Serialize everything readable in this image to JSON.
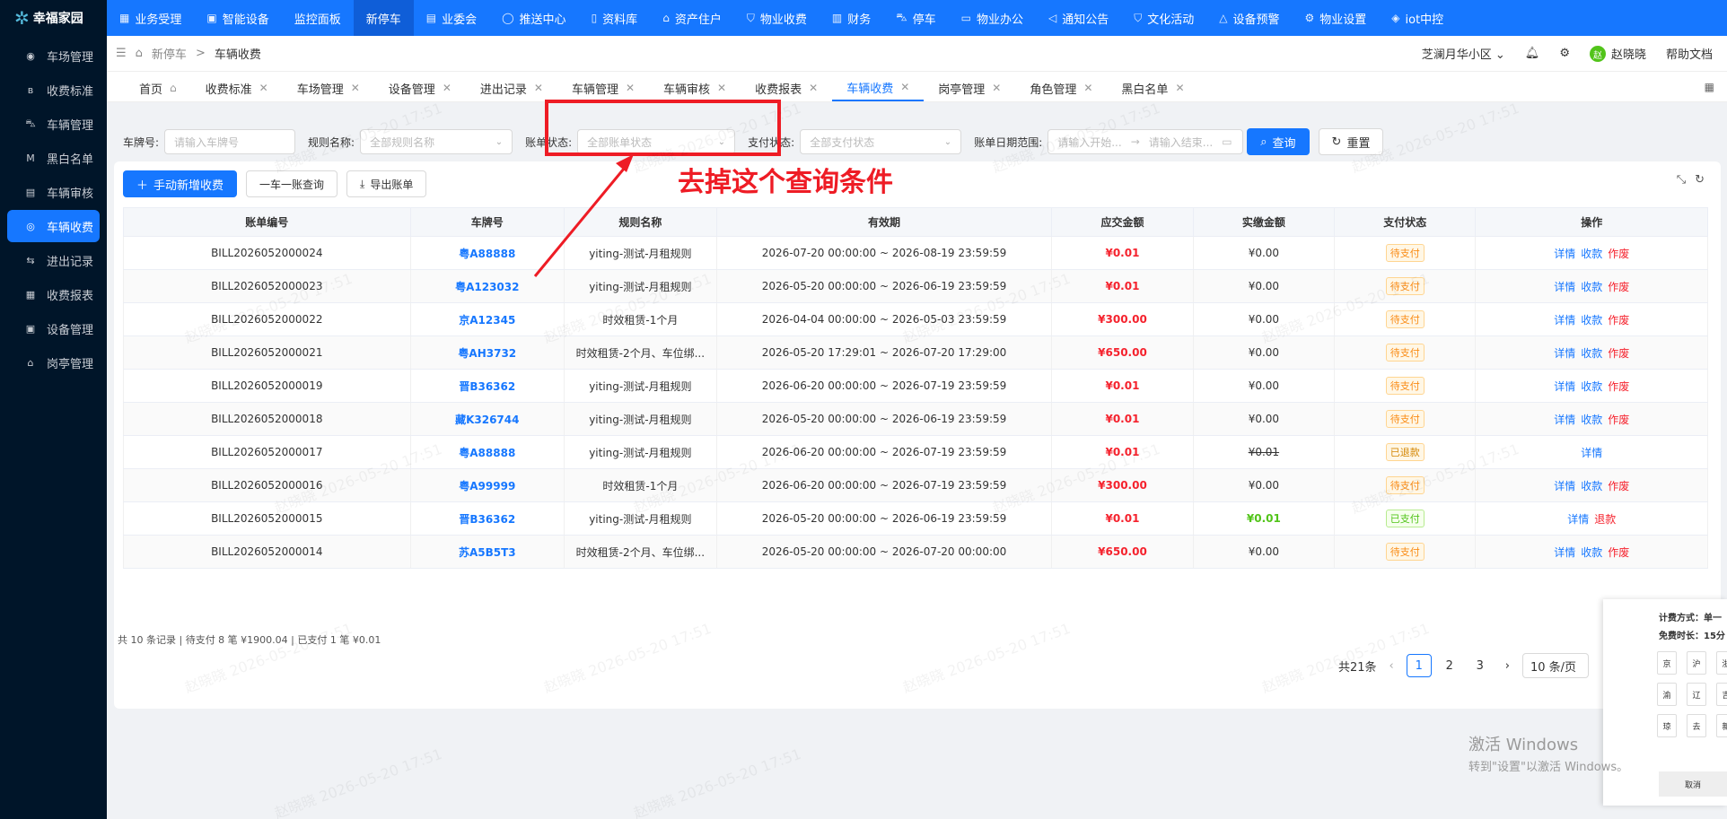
{
  "brand": {
    "name": "幸福家园"
  },
  "top_nav": [
    {
      "icon": "grid-icon",
      "label": "业务受理",
      "active": false
    },
    {
      "icon": "device-icon",
      "label": "智能设备",
      "active": false
    },
    {
      "icon": "",
      "label": "监控面板",
      "active": false
    },
    {
      "icon": "",
      "label": "新停车",
      "active": true
    },
    {
      "icon": "doc-icon",
      "label": "业委会",
      "active": false
    },
    {
      "icon": "circle-icon",
      "label": "推送中心",
      "active": false
    },
    {
      "icon": "file-icon",
      "label": "资料库",
      "active": false
    },
    {
      "icon": "home-icon",
      "label": "资产住户",
      "active": false
    },
    {
      "icon": "shield-icon",
      "label": "物业收费",
      "active": false
    },
    {
      "icon": "money-icon",
      "label": "财务",
      "active": false
    },
    {
      "icon": "car-icon",
      "label": "停车",
      "active": false
    },
    {
      "icon": "monitor-icon",
      "label": "物业办公",
      "active": false
    },
    {
      "icon": "speaker-icon",
      "label": "通知公告",
      "active": false
    },
    {
      "icon": "shield-icon",
      "label": "文化活动",
      "active": false
    },
    {
      "icon": "bell-icon",
      "label": "设备预警",
      "active": false
    },
    {
      "icon": "gear-icon",
      "label": "物业设置",
      "active": false
    },
    {
      "icon": "cube-icon",
      "label": "iot中控",
      "active": false
    }
  ],
  "sidebar": [
    {
      "icon": "lot-icon",
      "label": "车场管理",
      "active": false
    },
    {
      "icon": "fee-icon",
      "label": "收费标准",
      "active": false
    },
    {
      "icon": "car-icon",
      "label": "车辆管理",
      "active": false
    },
    {
      "icon": "list-icon",
      "label": "黑白名单",
      "active": false
    },
    {
      "icon": "audit-icon",
      "label": "车辆审核",
      "active": false
    },
    {
      "icon": "coin-icon",
      "label": "车辆收费",
      "active": true
    },
    {
      "icon": "inout-icon",
      "label": "进出记录",
      "active": false
    },
    {
      "icon": "report-icon",
      "label": "收费报表",
      "active": false
    },
    {
      "icon": "device-icon",
      "label": "设备管理",
      "active": false
    },
    {
      "icon": "booth-icon",
      "label": "岗亭管理",
      "active": false
    }
  ],
  "breadcrumb": {
    "parent": "新停车",
    "current": "车辆收费"
  },
  "header_right": {
    "community": "芝澜月华小区",
    "user": "赵晓晓",
    "avatar_text": "赵",
    "help": "帮助文档"
  },
  "tabs": [
    {
      "label": "首页",
      "closable": false
    },
    {
      "label": "收费标准",
      "closable": true
    },
    {
      "label": "车场管理",
      "closable": true
    },
    {
      "label": "设备管理",
      "closable": true
    },
    {
      "label": "进出记录",
      "closable": true
    },
    {
      "label": "车辆管理",
      "closable": true
    },
    {
      "label": "车辆审核",
      "closable": true
    },
    {
      "label": "收费报表",
      "closable": true
    },
    {
      "label": "车辆收费",
      "closable": true,
      "active": true
    },
    {
      "label": "岗亭管理",
      "closable": true
    },
    {
      "label": "角色管理",
      "closable": true
    },
    {
      "label": "黑白名单",
      "closable": true
    }
  ],
  "filters": {
    "plate_label": "车牌号:",
    "plate_placeholder": "请输入车牌号",
    "rule_label": "规则名称:",
    "rule_placeholder": "全部规则名称",
    "bill_status_label": "账单状态:",
    "bill_status_placeholder": "全部账单状态",
    "pay_status_label": "支付状态:",
    "pay_status_placeholder": "全部支付状态",
    "date_label": "账单日期范围:",
    "date_start_placeholder": "请输入开始...",
    "date_end_placeholder": "请输入结束...",
    "query_label": "查询",
    "reset_label": "重置"
  },
  "toolbar": {
    "add_label": "手动新增收费",
    "one_car_label": "一车一账查询",
    "export_label": "导出账单"
  },
  "table": {
    "headers": [
      "账单编号",
      "车牌号",
      "规则名称",
      "有效期",
      "应交金额",
      "实缴金额",
      "支付状态",
      "操作"
    ],
    "rows": [
      {
        "id": "BILL2026052000024",
        "plate": "粤A88888",
        "rule": "yiting-测试-月租规则",
        "period": "2026-07-20 00:00:00 ~ 2026-08-19 23:59:59",
        "due": "¥0.01",
        "paid": "¥0.00",
        "status": "待支付",
        "status_type": "pending",
        "ops": [
          "详情",
          "收款",
          "作废"
        ]
      },
      {
        "id": "BILL2026052000023",
        "plate": "粤A123032",
        "rule": "yiting-测试-月租规则",
        "period": "2026-05-20 00:00:00 ~ 2026-06-19 23:59:59",
        "due": "¥0.01",
        "paid": "¥0.00",
        "status": "待支付",
        "status_type": "pending",
        "ops": [
          "详情",
          "收款",
          "作废"
        ]
      },
      {
        "id": "BILL2026052000022",
        "plate": "京A12345",
        "rule": "时效租赁-1个月",
        "period": "2026-04-04 00:00:00 ~ 2026-05-03 23:59:59",
        "due": "¥300.00",
        "paid": "¥0.00",
        "status": "待支付",
        "status_type": "pending",
        "ops": [
          "详情",
          "收款",
          "作废"
        ]
      },
      {
        "id": "BILL2026052000021",
        "plate": "粤AH3732",
        "rule": "时效租赁-2个月、车位绑...",
        "period": "2026-05-20 17:29:01 ~ 2026-07-20 17:29:00",
        "due": "¥650.00",
        "paid": "¥0.00",
        "status": "待支付",
        "status_type": "pending",
        "ops": [
          "详情",
          "收款",
          "作废"
        ]
      },
      {
        "id": "BILL2026052000019",
        "plate": "晋B36362",
        "rule": "yiting-测试-月租规则",
        "period": "2026-06-20 00:00:00 ~ 2026-07-19 23:59:59",
        "due": "¥0.01",
        "paid": "¥0.00",
        "status": "待支付",
        "status_type": "pending",
        "ops": [
          "详情",
          "收款",
          "作废"
        ]
      },
      {
        "id": "BILL2026052000018",
        "plate": "藏K326744",
        "rule": "yiting-测试-月租规则",
        "period": "2026-05-20 00:00:00 ~ 2026-06-19 23:59:59",
        "due": "¥0.01",
        "paid": "¥0.00",
        "status": "待支付",
        "status_type": "pending",
        "ops": [
          "详情",
          "收款",
          "作废"
        ]
      },
      {
        "id": "BILL2026052000017",
        "plate": "粤A88888",
        "rule": "yiting-测试-月租规则",
        "period": "2026-06-20 00:00:00 ~ 2026-07-19 23:59:59",
        "due": "¥0.01",
        "paid": "¥0.01",
        "status": "已退款",
        "status_type": "refund",
        "ops": [
          "详情"
        ]
      },
      {
        "id": "BILL2026052000016",
        "plate": "粤A99999",
        "rule": "时效租赁-1个月",
        "period": "2026-06-20 00:00:00 ~ 2026-07-19 23:59:59",
        "due": "¥300.00",
        "paid": "¥0.00",
        "status": "待支付",
        "status_type": "pending",
        "ops": [
          "详情",
          "收款",
          "作废"
        ]
      },
      {
        "id": "BILL2026052000015",
        "plate": "晋B36362",
        "rule": "yiting-测试-月租规则",
        "period": "2026-05-20 00:00:00 ~ 2026-06-19 23:59:59",
        "due": "¥0.01",
        "paid": "¥0.01",
        "status": "已支付",
        "status_type": "paid",
        "ops": [
          "详情",
          "退款"
        ]
      },
      {
        "id": "BILL2026052000014",
        "plate": "苏A5B5T3",
        "rule": "时效租赁-2个月、车位绑...",
        "period": "2026-05-20 00:00:00 ~ 2026-07-20 00:00:00",
        "due": "¥650.00",
        "paid": "¥0.00",
        "status": "待支付",
        "status_type": "pending",
        "ops": [
          "详情",
          "收款",
          "作废"
        ]
      }
    ]
  },
  "summary": "共 10 条记录 | 待支付 8 笔 ¥1900.04 | 已支付 1 笔 ¥0.01",
  "pagination": {
    "total": "共21条",
    "pages": [
      "1",
      "2",
      "3"
    ],
    "current": "1",
    "page_size": "10 条/页"
  },
  "annotation": {
    "text": "去掉这个查询条件",
    "color": "#ee1c25"
  },
  "side_panel": {
    "line1": "计费方式：单一",
    "line2": "免费时长：15分",
    "keys": [
      "京",
      "沪",
      "浙",
      "渝",
      "辽",
      "吉",
      "琼",
      "去",
      "新"
    ],
    "cancel": "取消"
  },
  "windows_activation": {
    "title": "激活 Windows",
    "subtitle": "转到\"设置\"以激活 Windows。"
  },
  "watermark": "赵晓晓 2026-05-20 17:51"
}
